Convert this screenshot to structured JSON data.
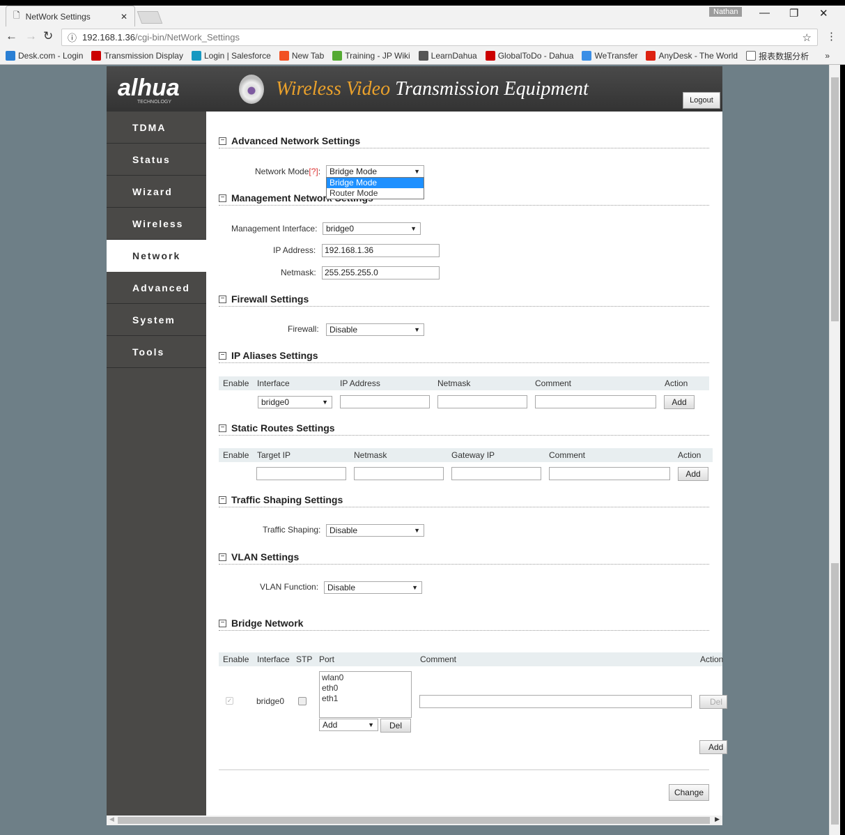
{
  "browser": {
    "tab_title": "NetWork Settings",
    "user": "Nathan",
    "url_host": "192.168.1.36",
    "url_path": "/cgi-bin/NetWork_Settings",
    "bookmarks": [
      {
        "label": "Desk.com - Login",
        "color": "#2a7fd4"
      },
      {
        "label": "Transmission Display",
        "color": "#c00"
      },
      {
        "label": "Login | Salesforce",
        "color": "#1798c1"
      },
      {
        "label": "New Tab",
        "color": "#f25022"
      },
      {
        "label": "Training - JP Wiki",
        "color": "#5a3"
      },
      {
        "label": "LearnDahua",
        "color": "#555"
      },
      {
        "label": "GlobalToDo - Dahua",
        "color": "#c00"
      },
      {
        "label": "WeTransfer",
        "color": "#3a8ee6"
      },
      {
        "label": "AnyDesk - The World",
        "color": "#d21"
      },
      {
        "label": "报表数据分析",
        "color": "#fff"
      }
    ]
  },
  "header": {
    "logo": "alhua",
    "logo_sub": "TECHNOLOGY",
    "title_accent": "Wireless Video",
    "title_rest": "Transmission Equipment",
    "logout": "Logout"
  },
  "nav": [
    "TDMA",
    "Status",
    "Wizard",
    "Wireless",
    "Network",
    "Advanced",
    "System",
    "Tools"
  ],
  "active_nav": "Network",
  "advanced": {
    "title": "Advanced Network Settings",
    "mode_label": "Network Mode",
    "help": "[?]",
    "colon": ":",
    "mode_value": "Bridge Mode",
    "options": [
      "Bridge Mode",
      "Router Mode"
    ]
  },
  "management": {
    "title": "Management Network Settings",
    "iface_label": "Management Interface:",
    "iface_value": "bridge0",
    "ip_label": "IP Address:",
    "ip_value": "192.168.1.36",
    "mask_label": "Netmask:",
    "mask_value": "255.255.255.0"
  },
  "firewall": {
    "title": "Firewall Settings",
    "label": "Firewall:",
    "value": "Disable"
  },
  "aliases": {
    "title": "IP Aliases Settings",
    "headers": [
      "Enable",
      "Interface",
      "IP Address",
      "Netmask",
      "Comment",
      "Action"
    ],
    "iface_value": "bridge0",
    "add": "Add"
  },
  "routes": {
    "title": "Static Routes Settings",
    "headers": [
      "Enable",
      "Target IP",
      "Netmask",
      "Gateway IP",
      "Comment",
      "Action"
    ],
    "add": "Add"
  },
  "traffic": {
    "title": "Traffic Shaping Settings",
    "label": "Traffic Shaping:",
    "value": "Disable"
  },
  "vlan": {
    "title": "VLAN Settings",
    "label": "VLAN Function:",
    "value": "Disable"
  },
  "bridge": {
    "title": "Bridge Network",
    "headers": [
      "Enable",
      "Interface",
      "STP",
      "Port",
      "Comment",
      "Action"
    ],
    "iface": "bridge0",
    "ports": [
      "wlan0",
      "eth0",
      "eth1"
    ],
    "port_add": "Add",
    "port_del": "Del",
    "del": "Del",
    "add": "Add"
  },
  "change": "Change"
}
